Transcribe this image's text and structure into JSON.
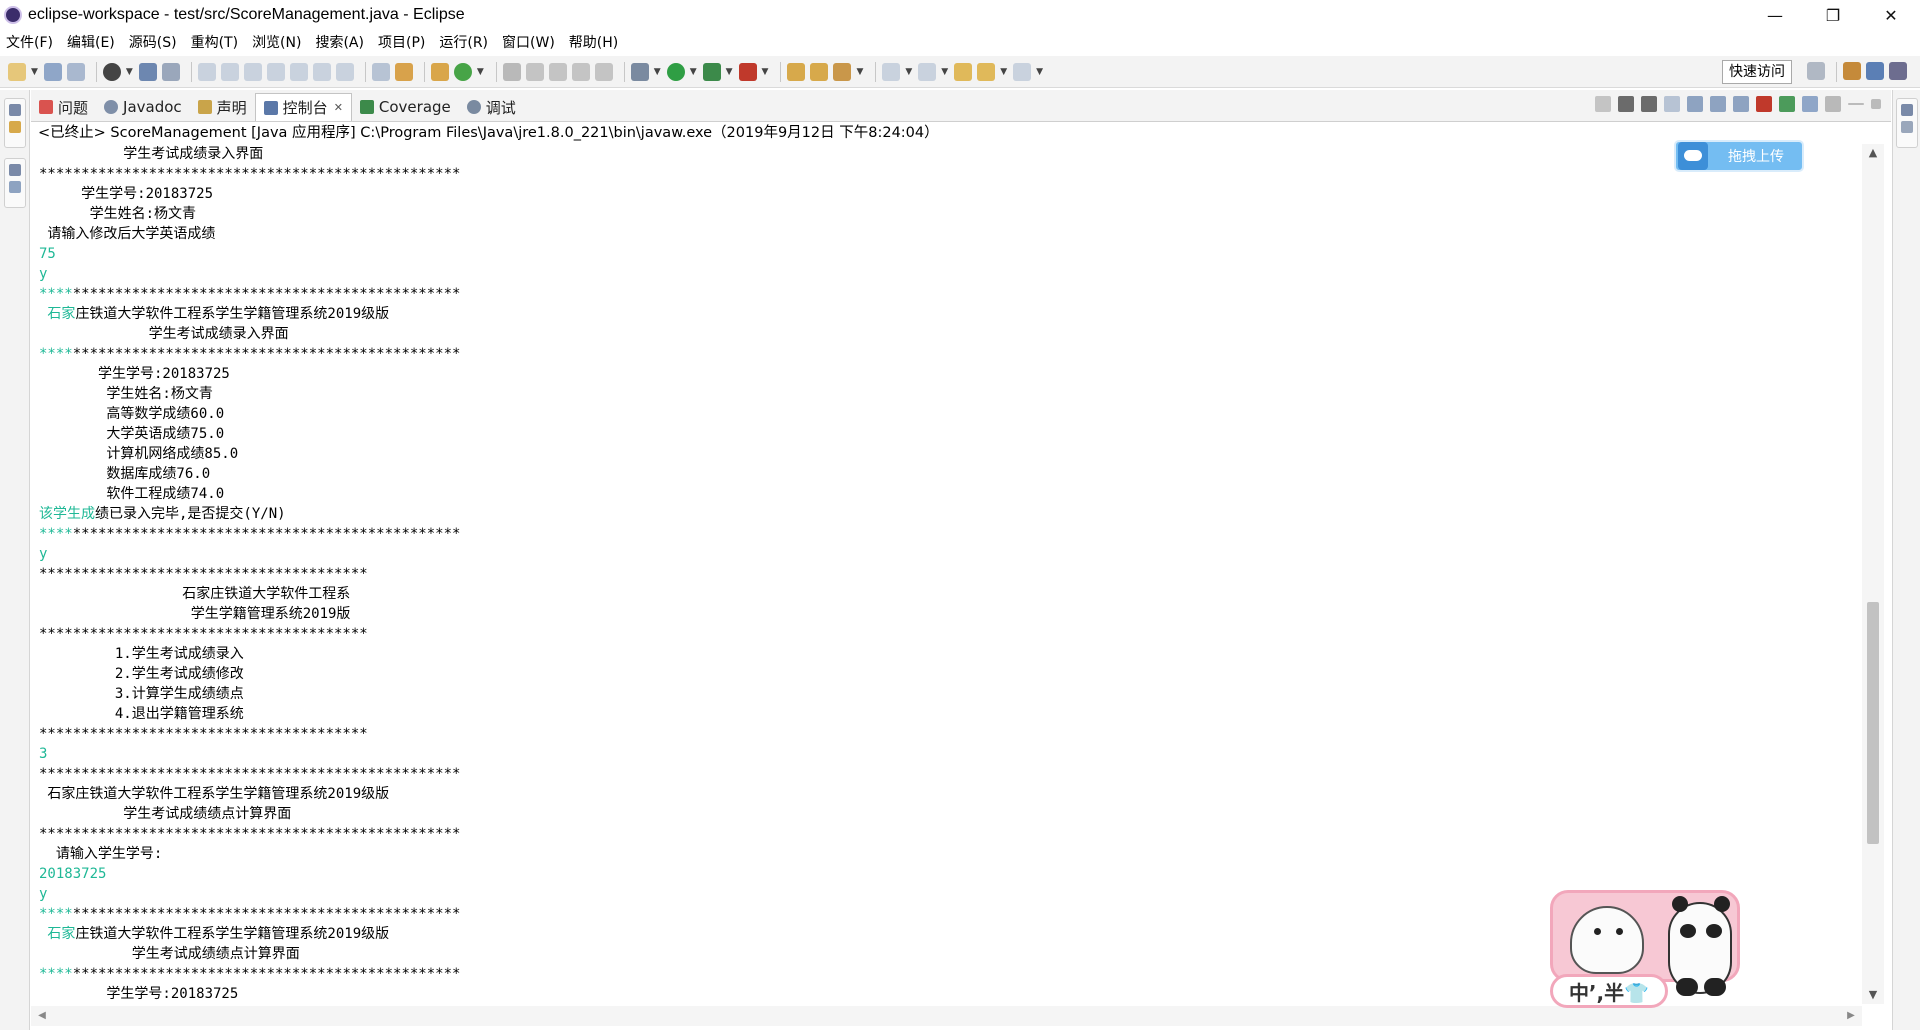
{
  "window": {
    "title": "eclipse-workspace - test/src/ScoreManagement.java - Eclipse",
    "controls": {
      "minimize": "—",
      "restore": "❐",
      "close": "✕"
    }
  },
  "menu": [
    "文件(F)",
    "编辑(E)",
    "源码(S)",
    "重构(T)",
    "浏览(N)",
    "搜索(A)",
    "项目(P)",
    "运行(R)",
    "窗口(W)",
    "帮助(H)"
  ],
  "toolbar": {
    "quick_access": "快速访问"
  },
  "tabs": [
    {
      "label": "问题",
      "icon": "problems-icon",
      "active": false
    },
    {
      "label": "Javadoc",
      "icon": "javadoc-icon",
      "active": false
    },
    {
      "label": "声明",
      "icon": "declaration-icon",
      "active": false
    },
    {
      "label": "控制台",
      "icon": "console-icon",
      "active": true,
      "close": "✕"
    },
    {
      "label": "Coverage",
      "icon": "coverage-icon",
      "active": false
    },
    {
      "label": "调试",
      "icon": "debug-icon",
      "active": false
    }
  ],
  "console": {
    "status": "<已终止> ScoreManagement [Java 应用程序] C:\\Program Files\\Java\\jre1.8.0_221\\bin\\javaw.exe（2019年9月12日 下午8:24:04）",
    "lines": [
      {
        "text": "          学生考试成绩录入界面",
        "type": "output"
      },
      {
        "text": "**************************************************",
        "type": "output"
      },
      {
        "text": "     学生学号:20183725",
        "type": "output"
      },
      {
        "text": "      学生姓名:杨文青",
        "type": "output"
      },
      {
        "text": " 请输入修改后大学英语成绩",
        "type": "output"
      },
      {
        "text": "75",
        "type": "input"
      },
      {
        "text": "y",
        "type": "input"
      },
      {
        "text": "**************************************************",
        "type": "mixed",
        "prefix": "****"
      },
      {
        "text": " 石家庄铁道大学软件工程系学生学籍管理系统2019级版",
        "type": "mixed",
        "prefix": " 石家"
      },
      {
        "text": "             学生考试成绩录入界面",
        "type": "output"
      },
      {
        "text": "**************************************************",
        "type": "mixed",
        "prefix": "****"
      },
      {
        "text": "       学生学号:20183725",
        "type": "output"
      },
      {
        "text": "        学生姓名:杨文青",
        "type": "output"
      },
      {
        "text": "        高等数学成绩60.0",
        "type": "output"
      },
      {
        "text": "        大学英语成绩75.0",
        "type": "output"
      },
      {
        "text": "        计算机网络成绩85.0",
        "type": "output"
      },
      {
        "text": "        数据库成绩76.0",
        "type": "output"
      },
      {
        "text": "        软件工程成绩74.0",
        "type": "output"
      },
      {
        "text": "该学生成绩已录入完毕,是否提交(Y/N)",
        "type": "mixed",
        "prefix": "该学生成"
      },
      {
        "text": "**************************************************",
        "type": "mixed",
        "prefix": "****"
      },
      {
        "text": "y",
        "type": "input"
      },
      {
        "text": "***************************************",
        "type": "output"
      },
      {
        "text": "                 石家庄铁道大学软件工程系",
        "type": "output"
      },
      {
        "text": "                  学生学籍管理系统2019版",
        "type": "output"
      },
      {
        "text": "***************************************",
        "type": "output"
      },
      {
        "text": "         1.学生考试成绩录入",
        "type": "output"
      },
      {
        "text": "         2.学生考试成绩修改",
        "type": "output"
      },
      {
        "text": "         3.计算学生成绩绩点",
        "type": "output"
      },
      {
        "text": "         4.退出学籍管理系统",
        "type": "output"
      },
      {
        "text": "***************************************",
        "type": "output"
      },
      {
        "text": "3",
        "type": "input"
      },
      {
        "text": "**************************************************",
        "type": "output"
      },
      {
        "text": " 石家庄铁道大学软件工程系学生学籍管理系统2019级版",
        "type": "output"
      },
      {
        "text": "          学生考试成绩绩点计算界面",
        "type": "output"
      },
      {
        "text": "**************************************************",
        "type": "output"
      },
      {
        "text": "  请输入学生学号:",
        "type": "output"
      },
      {
        "text": "20183725",
        "type": "input"
      },
      {
        "text": "y",
        "type": "input"
      },
      {
        "text": "**************************************************",
        "type": "mixed",
        "prefix": "****"
      },
      {
        "text": " 石家庄铁道大学软件工程系学生学籍管理系统2019级版",
        "type": "mixed",
        "prefix": " 石家"
      },
      {
        "text": "           学生考试成绩绩点计算界面",
        "type": "output"
      },
      {
        "text": "**************************************************",
        "type": "mixed",
        "prefix": "****"
      },
      {
        "text": "        学生学号:20183725",
        "type": "output"
      }
    ]
  },
  "upload_widget": {
    "label": "拖拽上传"
  },
  "ime": {
    "text": "中’,半👕"
  },
  "colors": {
    "input_text": "#1fb896",
    "accent": "#3d8fd8"
  }
}
